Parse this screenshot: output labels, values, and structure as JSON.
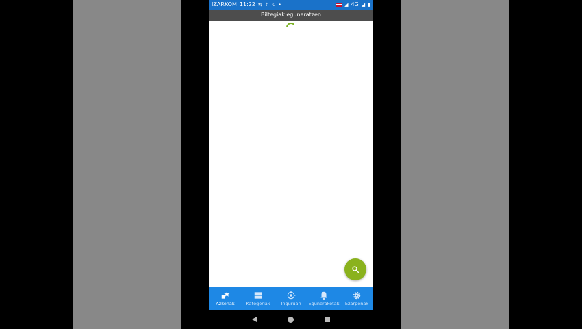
{
  "status_bar": {
    "carrier": "IZARKOM",
    "time": "11:22",
    "network": "4G"
  },
  "banner": {
    "text": "Biltegiak eguneratzen"
  },
  "fab": {
    "icon": "search-icon"
  },
  "bottom_nav": {
    "items": [
      {
        "label": "Azkenak",
        "icon": "star-new-icon",
        "active": true
      },
      {
        "label": "Kategoriak",
        "icon": "categories-icon",
        "active": false
      },
      {
        "label": "Inguruan",
        "icon": "nearby-icon",
        "active": false
      },
      {
        "label": "Eguneraketak",
        "icon": "bell-icon",
        "active": false
      },
      {
        "label": "Ezarpenak",
        "icon": "gear-icon",
        "active": false
      }
    ]
  },
  "colors": {
    "status_bar": "#1a72c9",
    "banner": "#4d4d4d",
    "bottom_nav": "#1e88e5",
    "accent": "#8ab21d"
  }
}
